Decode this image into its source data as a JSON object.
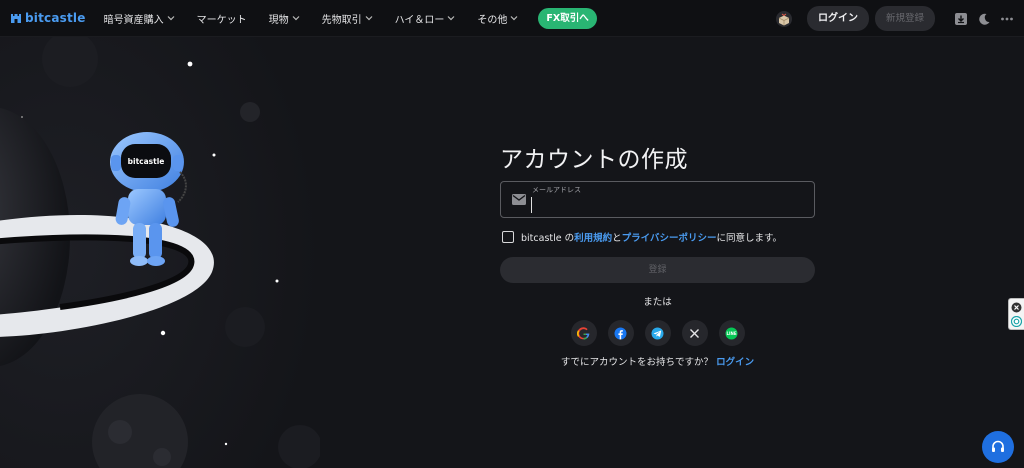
{
  "header": {
    "logo_text": "bitcastle",
    "nav": [
      {
        "label": "暗号資産購入",
        "has_dropdown": true
      },
      {
        "label": "マーケット",
        "has_dropdown": false
      },
      {
        "label": "現物",
        "has_dropdown": true
      },
      {
        "label": "先物取引",
        "has_dropdown": true
      },
      {
        "label": "ハイ＆ロー",
        "has_dropdown": true
      },
      {
        "label": "その他",
        "has_dropdown": true
      }
    ],
    "fx_button": "FX取引へ",
    "login_button": "ログイン",
    "signup_button": "新規登録"
  },
  "art": {
    "helmet_text": "bitcastle"
  },
  "form": {
    "title": "アカウントの作成",
    "email_label": "メールアドレス",
    "email_value": "",
    "agree_prefix": "bitcastle の",
    "terms_link": "利用規約",
    "agree_mid": "と",
    "privacy_link": "プライバシーポリシー",
    "agree_suffix": "に同意します。",
    "register_button": "登録",
    "or_text": "または",
    "socials": [
      "google-icon",
      "facebook-icon",
      "telegram-icon",
      "x-icon",
      "line-icon"
    ],
    "line_icon_text": "LINE",
    "already_text": "すでにアカウントをお持ちですか？",
    "login_link": "ログイン"
  },
  "colors": {
    "accent_blue": "#4a9bf0",
    "fx_green": "#29b573",
    "background": "#141519"
  }
}
